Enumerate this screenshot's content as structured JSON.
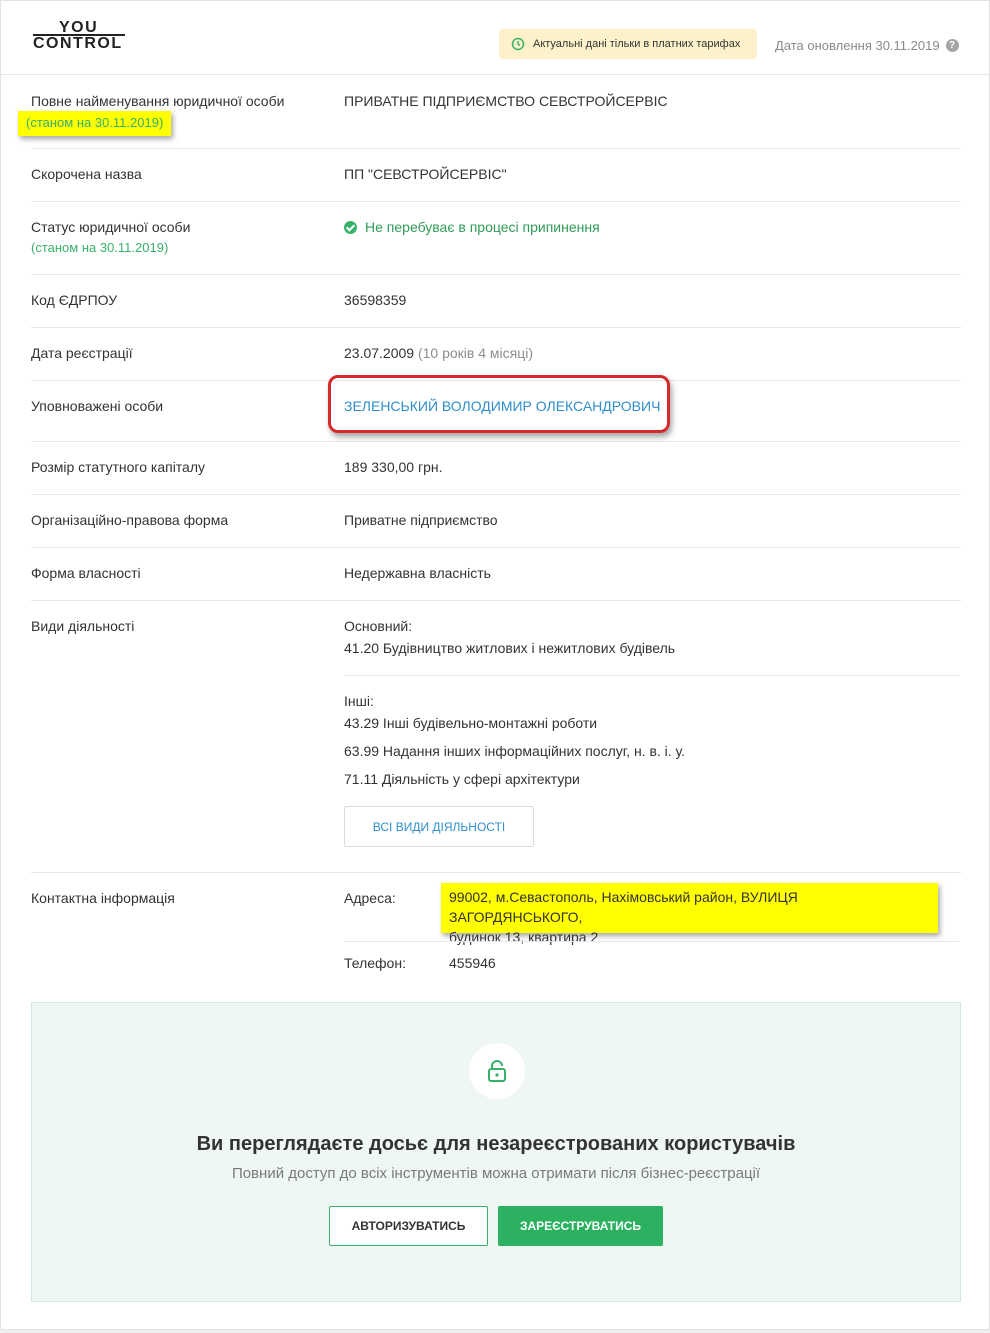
{
  "header": {
    "logo_top": "YOU",
    "logo_bottom": "CONTROL",
    "notice": "Актуальні дані тільки в платних тарифах",
    "update_date": "Дата оновлення 30.11.2019"
  },
  "rows": {
    "full_name": {
      "label": "Повне найменування юридичної особи",
      "note": "(станом на 30.11.2019)",
      "value": "ПРИВАТНЕ ПІДПРИЄМСТВО СЕВСТРОЙСЕРВІС"
    },
    "short_name": {
      "label": "Скорочена назва",
      "value": "ПП \"СЕВСТРОЙСЕРВІС\""
    },
    "status": {
      "label": "Статус юридичної особи",
      "note": "(станом на 30.11.2019)",
      "value": "Не перебуває в процесі припинення"
    },
    "edrpou": {
      "label": "Код ЄДРПОУ",
      "value": "36598359"
    },
    "reg_date": {
      "label": "Дата реєстрації",
      "value": "23.07.2009",
      "age": "(10 років 4 місяці)"
    },
    "authorized": {
      "label": "Уповноважені особи",
      "value": "ЗЕЛЕНСЬКИЙ ВОЛОДИМИР ОЛЕКСАНДРОВИЧ"
    },
    "capital": {
      "label": "Розмір статутного капіталу",
      "value": "189 330,00 грн."
    },
    "legal_form": {
      "label": "Організаційно-правова форма",
      "value": "Приватне підприємство"
    },
    "ownership": {
      "label": "Форма власності",
      "value": "Недержавна власність"
    },
    "activities": {
      "label": "Види діяльності",
      "main_label": "Основний:",
      "main": "41.20 Будівництво житлових і нежитлових будівель",
      "other_label": "Інші:",
      "other": [
        "43.29 Інші будівельно-монтажні роботи",
        "63.99 Надання інших інформаційних послуг, н. в. і. у.",
        "71.11 Діяльність у сфері архітектури"
      ],
      "all_button": "ВСІ ВИДИ ДІЯЛЬНОСТІ"
    },
    "contacts": {
      "label": "Контактна інформація",
      "address_label": "Адреса:",
      "address_line1": "99002, м.Севастополь, Нахімовський район, ВУЛИЦЯ ЗАГОРДЯНСЬКОГО,",
      "address_line2": "будинок 13, квартира 2",
      "phone_label": "Телефон:",
      "phone": "455946"
    }
  },
  "cta": {
    "title": "Ви переглядаєте досьє для незареєстрованих користувачів",
    "subtitle": "Повний доступ до всіх інструментів можна отримати після бізнес-реєстрації",
    "login": "АВТОРИЗУВАТИСЬ",
    "register": "ЗАРЕЄСТРУВАТИСЬ"
  },
  "colors": {
    "green": "#2bb15f",
    "link": "#2f8ecb",
    "highlight": "#ffff00",
    "annotation_red": "#d42a2a"
  }
}
